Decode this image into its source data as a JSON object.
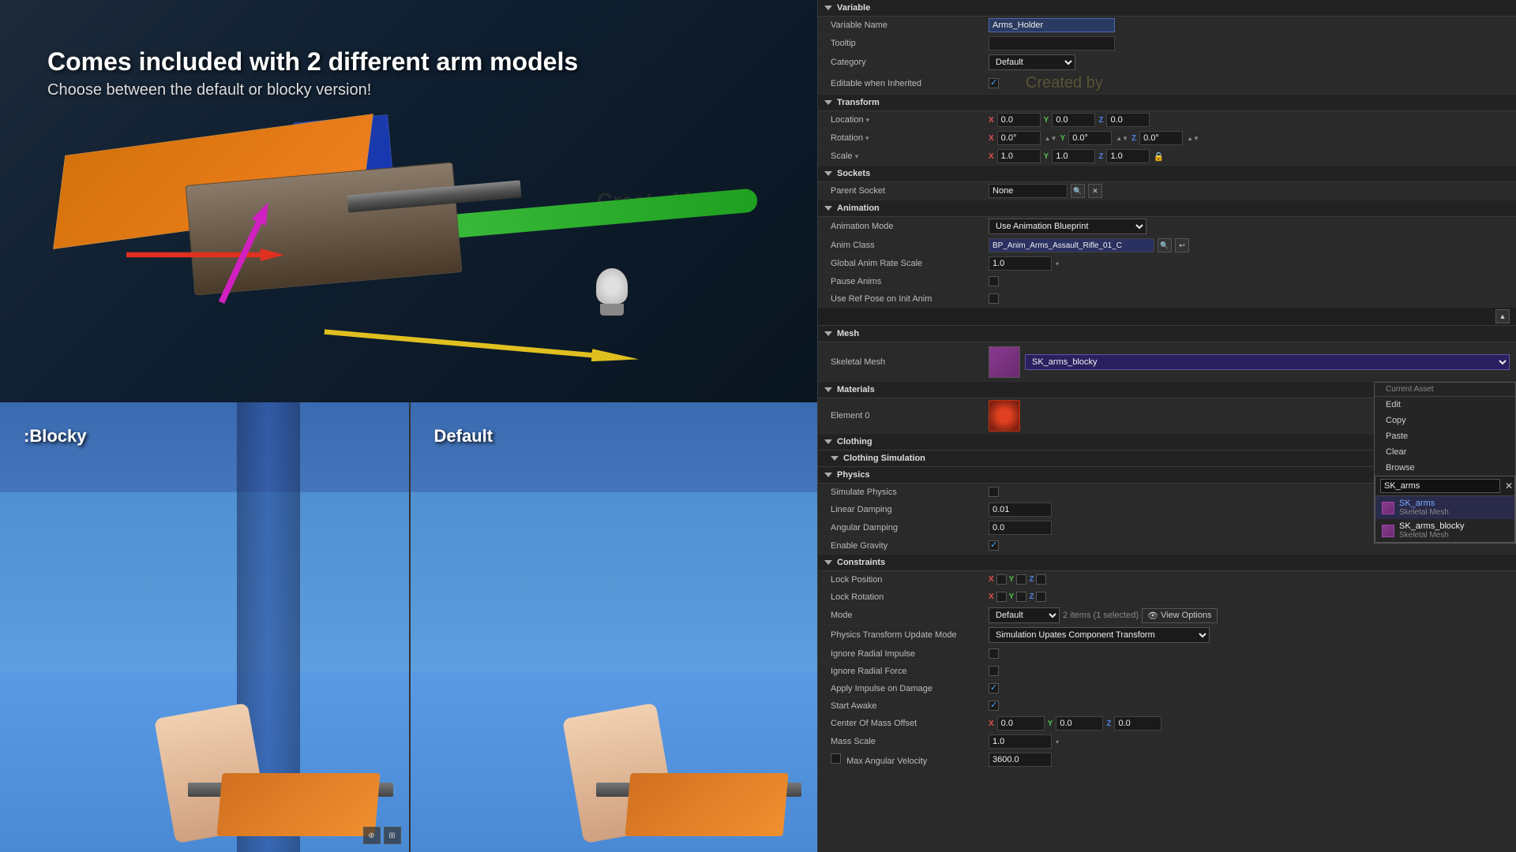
{
  "hero": {
    "title": "Comes included with 2 different arm models",
    "subtitle": "Choose between the default or blocky version!",
    "watermark": "Created by"
  },
  "viewport": {
    "blocky_label": ":Blocky",
    "default_label": "Default"
  },
  "panel": {
    "variable_section": "Variable",
    "variable_name_label": "Variable Name",
    "variable_name_value": "Arms_Holder",
    "tooltip_label": "Tooltip",
    "category_label": "Category",
    "category_value": "Default",
    "editable_inherited_label": "Editable when Inherited",
    "transform_section": "Transform",
    "location_label": "Location",
    "location_x": "0.0",
    "location_y": "0.0",
    "location_z": "0.0",
    "rotation_label": "Rotation",
    "rotation_x": "0.0°",
    "rotation_y": "0.0°",
    "rotation_z": "0.0°",
    "scale_label": "Scale",
    "scale_x": "1.0",
    "scale_y": "1.0",
    "scale_z": "1.0",
    "sockets_section": "Sockets",
    "parent_socket_label": "Parent Socket",
    "parent_socket_value": "None",
    "animation_section": "Animation",
    "anim_mode_label": "Animation Mode",
    "anim_mode_value": "Use Animation Blueprint",
    "anim_class_label": "Anim Class",
    "anim_class_value": "BP_Anim_Arms_Assault_Rifle_01_C",
    "global_rate_label": "Global Anim Rate Scale",
    "global_rate_value": "1.0",
    "pause_anims_label": "Pause Anims",
    "use_ref_pose_label": "Use Ref Pose on Init Anim",
    "mesh_section": "Mesh",
    "skeletal_mesh_label": "Skeletal Mesh",
    "skeletal_mesh_value": "SK_arms_blocky",
    "context_menu": {
      "current_asset_label": "Current Asset",
      "edit": "Edit",
      "copy": "Copy",
      "paste": "Paste",
      "clear": "Clear",
      "browse": "Browse"
    },
    "asset_search_placeholder": "SK_arms",
    "asset_items": [
      {
        "name": "SK_arms",
        "type": "Skeletal Mesh",
        "highlighted": true
      },
      {
        "name": "SK_arms_blocky",
        "type": "Skeletal Mesh",
        "highlighted": false
      }
    ],
    "materials_section": "Materials",
    "element0_label": "Element 0",
    "clothing_section": "Clothing",
    "clothing_sim_section": "Clothing Simulation",
    "physics_section": "Physics",
    "simulate_physics_label": "Simulate Physics",
    "linear_damping_label": "Linear Damping",
    "linear_damping_value": "0.01",
    "angular_damping_label": "Angular Damping",
    "angular_damping_value": "0.0",
    "enable_gravity_label": "Enable Gravity",
    "constraints_section": "Constraints",
    "lock_position_label": "Lock Position",
    "lock_rotation_label": "Lock Rotation",
    "mode_label": "Mode",
    "mode_value": "Default",
    "items_count": "2 items (1 selected)",
    "view_options": "View Options",
    "physics_transform_label": "Physics Transform Update Mode",
    "physics_transform_value": "Simulation Upates Component Transform",
    "ignore_radial_impulse_label": "Ignore Radial Impulse",
    "ignore_radial_force_label": "Ignore Radial Force",
    "apply_impulse_label": "Apply Impulse on Damage",
    "start_awake_label": "Start Awake",
    "center_mass_label": "Center Of Mass Offset",
    "center_mass_x": "0.0",
    "center_mass_y": "0.0",
    "center_mass_z": "0.0",
    "mass_scale_label": "Mass Scale",
    "mass_scale_value": "1.0",
    "max_angular_label": "Max Angular Velocity",
    "max_angular_value": "3600.0"
  },
  "icons": {
    "collapse": "▼",
    "expand": "▶",
    "search": "🔍",
    "close": "✕",
    "lock": "🔒",
    "gear": "⚙",
    "up_arrow": "▲",
    "down_arrow": "▼",
    "eye": "👁",
    "magnify": "🔎",
    "chevron_down": "▾"
  }
}
